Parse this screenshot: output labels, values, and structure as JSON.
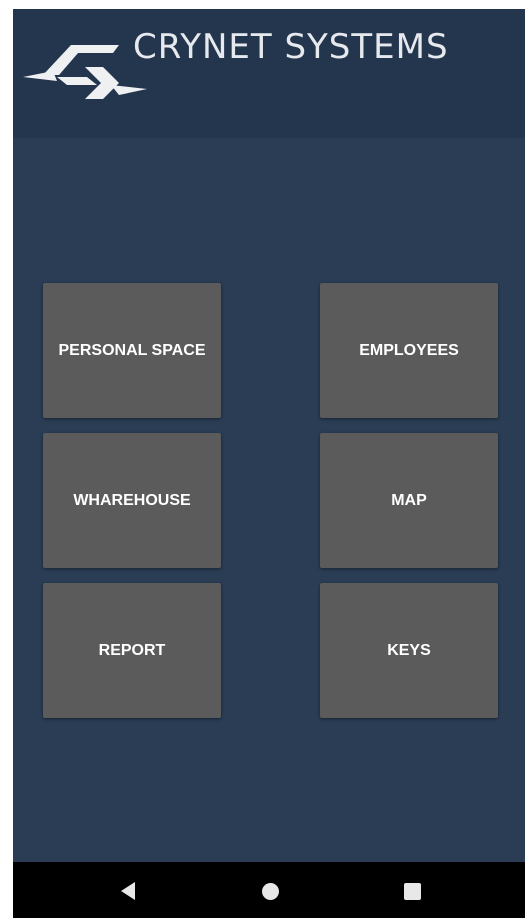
{
  "header": {
    "brand": "CRYNET SYSTEMS",
    "logo_icon": "crynet-logo-icon"
  },
  "menu": {
    "personal_space": "PERSONAL SPACE",
    "employees": "EMPLOYEES",
    "wharehouse": "WHAREHOUSE",
    "map": "MAP",
    "report": "REPORT",
    "keys": "KEYS"
  },
  "navbar": {
    "back_icon": "back-triangle-icon",
    "home_icon": "home-circle-icon",
    "recents_icon": "recents-square-icon"
  },
  "colors": {
    "background": "#2a3d55",
    "header": "#24364d",
    "tile": "#5b5b5b",
    "tile_text": "#ffffff",
    "navbar": "#000000"
  }
}
